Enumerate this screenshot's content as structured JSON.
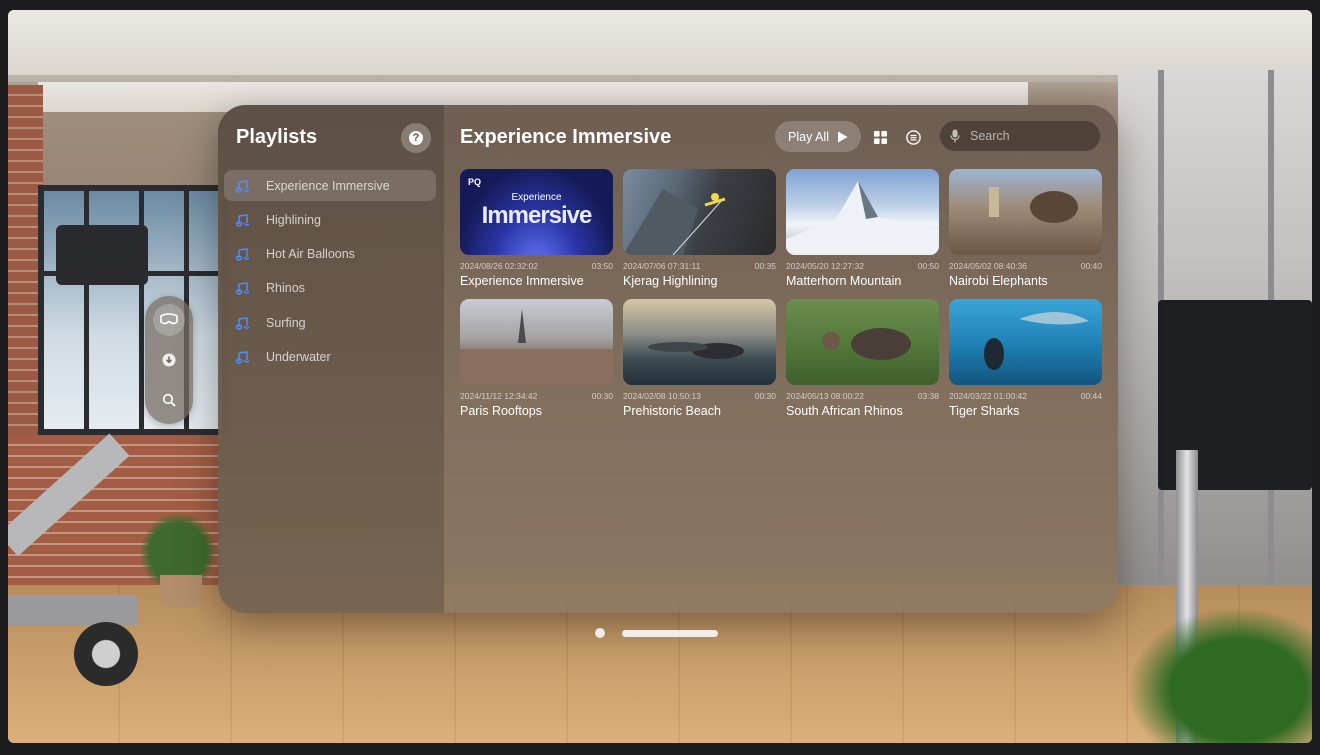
{
  "sidebar": {
    "title": "Playlists",
    "items": [
      {
        "label": "Experience Immersive",
        "selected": true
      },
      {
        "label": "Highlining",
        "selected": false
      },
      {
        "label": "Hot Air Balloons",
        "selected": false
      },
      {
        "label": "Rhinos",
        "selected": false
      },
      {
        "label": "Surfing",
        "selected": false
      },
      {
        "label": "Underwater",
        "selected": false
      }
    ]
  },
  "content": {
    "title": "Experience Immersive",
    "play_all_label": "Play All",
    "search_placeholder": "Search",
    "videos": [
      {
        "date": "2024/08/26 02:32:02",
        "duration": "03:50",
        "title": "Experience Immersive",
        "thumb_style": "t-imm",
        "thumb_badge": "PQ",
        "thumb_line1": "Experience",
        "thumb_line2": "Immersive"
      },
      {
        "date": "2024/07/06 07:31:11",
        "duration": "00:35",
        "title": "Kjerag Highlining",
        "thumb_style": "t-kje"
      },
      {
        "date": "2024/05/20 12:27:32",
        "duration": "00:50",
        "title": "Matterhorn Mountain",
        "thumb_style": "t-mat"
      },
      {
        "date": "2024/05/02 08:40:36",
        "duration": "00:40",
        "title": "Nairobi Elephants",
        "thumb_style": "t-nai"
      },
      {
        "date": "2024/11/12 12:34:42",
        "duration": "00:30",
        "title": "Paris Rooftops",
        "thumb_style": "t-par"
      },
      {
        "date": "2024/02/08 10:50:13",
        "duration": "00:30",
        "title": "Prehistoric Beach",
        "thumb_style": "t-pre"
      },
      {
        "date": "2024/05/13 08:00:22",
        "duration": "03:38",
        "title": "South African Rhinos",
        "thumb_style": "t-sar"
      },
      {
        "date": "2024/03/22 01:00:42",
        "duration": "00:44",
        "title": "Tiger Sharks",
        "thumb_style": "t-tig"
      }
    ]
  },
  "ornament": {
    "items": [
      {
        "icon": "vision-pro-icon",
        "active": true
      },
      {
        "icon": "download-icon",
        "active": false
      },
      {
        "icon": "search-icon",
        "active": false
      }
    ]
  },
  "colors": {
    "window_tint": "#6c5c50",
    "accent_text": "#ffffff"
  }
}
